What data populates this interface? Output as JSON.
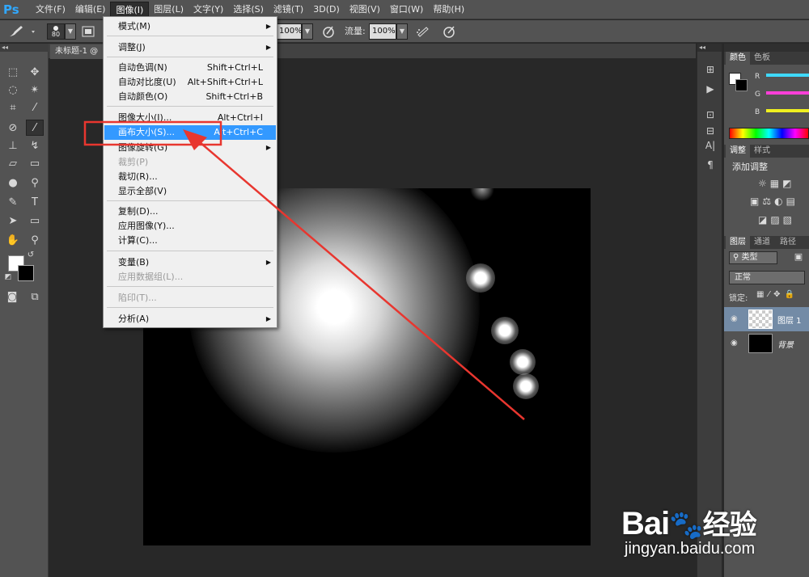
{
  "menubar": {
    "logo": "Ps",
    "items": [
      "文件(F)",
      "编辑(E)",
      "图像(I)",
      "图层(L)",
      "文字(Y)",
      "选择(S)",
      "滤镜(T)",
      "3D(D)",
      "视图(V)",
      "窗口(W)",
      "帮助(H)"
    ]
  },
  "options": {
    "brush_size": "80",
    "opacity_value": "100%",
    "flow_label": "流量:",
    "flow_value": "100%"
  },
  "document": {
    "tab_label": "未标题-1 @"
  },
  "image_menu": {
    "items": [
      {
        "label": "模式(M)",
        "shortcut": "",
        "submenu": true,
        "disabled": false
      },
      {
        "label": "调整(J)",
        "shortcut": "",
        "submenu": true,
        "disabled": false
      },
      {
        "label": "自动色调(N)",
        "shortcut": "Shift+Ctrl+L",
        "submenu": false,
        "disabled": false
      },
      {
        "label": "自动对比度(U)",
        "shortcut": "Alt+Shift+Ctrl+L",
        "submenu": false,
        "disabled": false
      },
      {
        "label": "自动颜色(O)",
        "shortcut": "Shift+Ctrl+B",
        "submenu": false,
        "disabled": false
      },
      {
        "label": "图像大小(I)...",
        "shortcut": "Alt+Ctrl+I",
        "submenu": false,
        "disabled": false
      },
      {
        "label": "画布大小(S)...",
        "shortcut": "Alt+Ctrl+C",
        "submenu": false,
        "disabled": false,
        "highlighted": true
      },
      {
        "label": "图像旋转(G)",
        "shortcut": "",
        "submenu": true,
        "disabled": false
      },
      {
        "label": "裁剪(P)",
        "shortcut": "",
        "submenu": false,
        "disabled": true
      },
      {
        "label": "裁切(R)...",
        "shortcut": "",
        "submenu": false,
        "disabled": false
      },
      {
        "label": "显示全部(V)",
        "shortcut": "",
        "submenu": false,
        "disabled": false
      },
      {
        "label": "复制(D)...",
        "shortcut": "",
        "submenu": false,
        "disabled": false
      },
      {
        "label": "应用图像(Y)...",
        "shortcut": "",
        "submenu": false,
        "disabled": false
      },
      {
        "label": "计算(C)...",
        "shortcut": "",
        "submenu": false,
        "disabled": false
      },
      {
        "label": "变量(B)",
        "shortcut": "",
        "submenu": true,
        "disabled": false
      },
      {
        "label": "应用数据组(L)...",
        "shortcut": "",
        "submenu": false,
        "disabled": true
      },
      {
        "label": "陷印(T)...",
        "shortcut": "",
        "submenu": false,
        "disabled": true
      },
      {
        "label": "分析(A)",
        "shortcut": "",
        "submenu": true,
        "disabled": false
      }
    ]
  },
  "color_panel": {
    "tabs": [
      "颜色",
      "色板"
    ],
    "channels": [
      "R",
      "G",
      "B"
    ],
    "channel_colors": [
      "#3fd9ff",
      "#ff3fd9",
      "#f0f020"
    ]
  },
  "adjust_panel": {
    "tabs": [
      "调整",
      "样式"
    ],
    "title": "添加调整"
  },
  "layers_panel": {
    "tabs": [
      "图层",
      "通道",
      "路径"
    ],
    "filter_label": "类型",
    "blend_mode": "正常",
    "lock_label": "锁定:",
    "layers": [
      {
        "name": "图层 1",
        "selected": true
      },
      {
        "name": "背景",
        "selected": false
      }
    ]
  },
  "annotation": {
    "highlight_color": "#e8362f"
  },
  "watermark": {
    "brand_left": "Bai",
    "brand_right": "经验",
    "url": "jingyan.baidu.com"
  }
}
